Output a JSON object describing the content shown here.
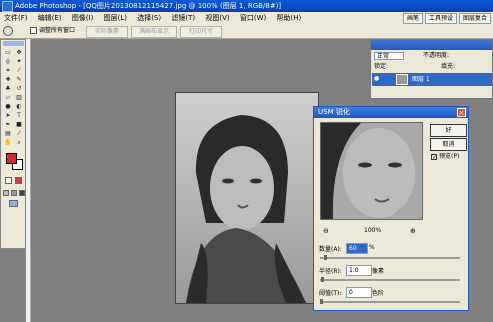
{
  "app": {
    "title_prefix": "Adobe Photoshop - ",
    "document_title": "[QQ图片20130812115427.jpg @ 100% (图层 1, RGB/8#)]"
  },
  "menu": [
    "文件(F)",
    "编辑(E)",
    "图像(I)",
    "图层(L)",
    "选择(S)",
    "滤镜(T)",
    "视图(V)",
    "窗口(W)",
    "帮助(H)"
  ],
  "workspace_tabs": [
    "画笔",
    "工具预设",
    "图层复合"
  ],
  "options": {
    "resize_all_windows": "调整所有窗口",
    "actual_pixels": "实际像素",
    "fit_screen": "满画布显示",
    "print_size": "打印尺寸"
  },
  "layers_panel": {
    "blend_mode": "正常",
    "opacity_label": "不透明度:",
    "lock_label": "锁定:",
    "fill_label": "填充:",
    "layer_name": "图层 1"
  },
  "dialog": {
    "title": "USM 锐化",
    "ok": "好",
    "cancel": "取消",
    "preview": "预览(P)",
    "zoom": "100%",
    "amount_label": "数量(A):",
    "amount_value": "60",
    "amount_unit": "%",
    "radius_label": "半径(R):",
    "radius_value": "1.0",
    "radius_unit": "像素",
    "threshold_label": "阈值(T):",
    "threshold_value": "0",
    "threshold_unit": "色阶"
  },
  "colors": {
    "foreground": "#d42a2a",
    "background": "#ffffff",
    "accent": "#2358c0"
  }
}
